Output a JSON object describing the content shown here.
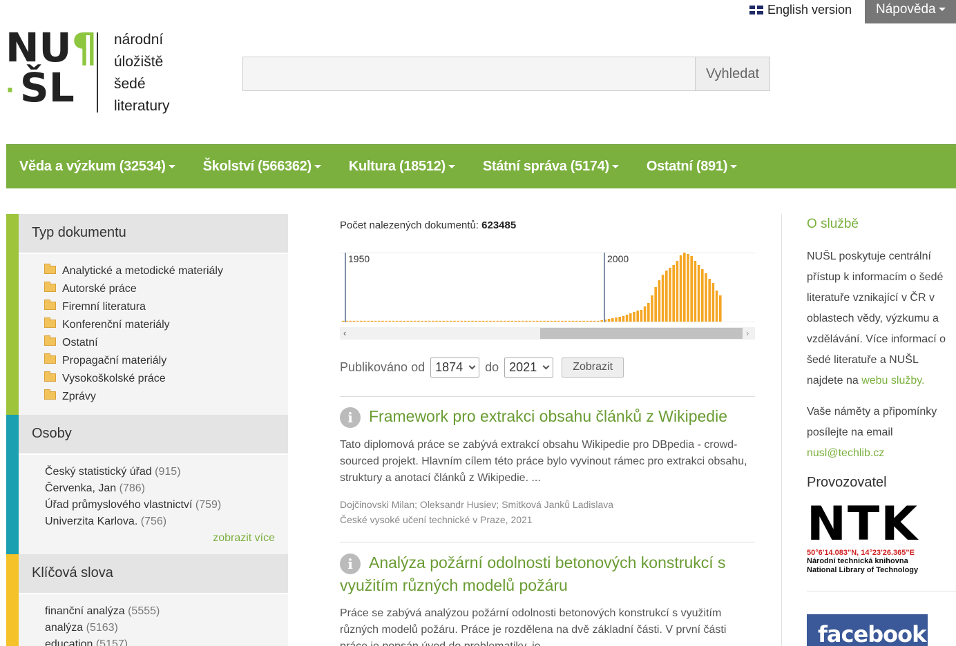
{
  "top": {
    "english_version": "English version",
    "help": "Nápověda"
  },
  "logo": {
    "mark_line1": "NU",
    "mark_para": "¶",
    "mark_line2_dot": "·",
    "mark_line2": "ŠL",
    "text_lines": [
      "národní",
      "úložiště",
      "šedé",
      "literatury"
    ]
  },
  "search": {
    "value": "",
    "button": "Vyhledat"
  },
  "nav": {
    "items": [
      "Věda a výzkum (32534)",
      "Školství (566362)",
      "Kultura (18512)",
      "Státní správa (5174)",
      "Ostatní (891)"
    ]
  },
  "facets": {
    "doc_type": {
      "title": "Typ dokumentu",
      "color": "#9dc43b",
      "items": [
        "Analytické a metodické materiály",
        "Autorské práce",
        "Firemní literatura",
        "Konferenční materiály",
        "Ostatní",
        "Propagační materiály",
        "Vysokoškolské práce",
        "Zprávy"
      ]
    },
    "persons": {
      "title": "Osoby",
      "color": "#1aa0b0",
      "items": [
        {
          "name": "Český statistický úřad",
          "count": "(915)"
        },
        {
          "name": "Červenka, Jan",
          "count": "(786)"
        },
        {
          "name": "Úřad průmyslového vlastnictví",
          "count": "(759)"
        },
        {
          "name": "Univerzita Karlova.",
          "count": "(756)"
        }
      ],
      "more": "zobrazit více"
    },
    "keywords": {
      "title": "Klíčová slova",
      "color": "#f5c22a",
      "items": [
        {
          "name": "finanční analýza",
          "count": "(5555)"
        },
        {
          "name": "analýza",
          "count": "(5163)"
        },
        {
          "name": "education",
          "count": "(5157)"
        }
      ]
    }
  },
  "results": {
    "count_label": "Počet nalezených dokumentů:",
    "count_value": "623485",
    "histogram": {
      "marker1": "1950",
      "marker2": "2000",
      "bar_color": "#f5a623",
      "bars": [
        0,
        0,
        0,
        0,
        0,
        0,
        0,
        0,
        0,
        0,
        0,
        0,
        0,
        0,
        0,
        0,
        0,
        0,
        0,
        0,
        0,
        0,
        0,
        0,
        0,
        0,
        0,
        0,
        0,
        0,
        0,
        0,
        0,
        0,
        0,
        0,
        0,
        0,
        0,
        0,
        0,
        0,
        0,
        0,
        0,
        0,
        0,
        0,
        0,
        0,
        0,
        0,
        0,
        0,
        0,
        0,
        0,
        0,
        0,
        0,
        0,
        0,
        0,
        0,
        0,
        0,
        0,
        0,
        0,
        0,
        1,
        1,
        2,
        3,
        4,
        5,
        6,
        7,
        8,
        10,
        12,
        14,
        16,
        17,
        22,
        27,
        38,
        50,
        60,
        68,
        74,
        78,
        82,
        88,
        96,
        100,
        98,
        95,
        88,
        82,
        76,
        70,
        62,
        56,
        45,
        38
      ],
      "scroll_left": "‹",
      "scroll_right": "›"
    },
    "published_from_label": "Publikováno od",
    "from_year": "1874",
    "to_label": "do",
    "to_year": "2021",
    "show_button": "Zobrazit",
    "records": [
      {
        "title": "Framework pro extrakci obsahu článků z Wikipedie",
        "abstract": "Tato diplomová práce se zabývá extrakcí obsahu Wikipedie pro DBpedia - crowd-sourced projekt. Hlavním cílem této práce bylo vyvinout rámec pro extrakci obsahu, struktury a anotací článků z Wikipedie. ...",
        "authors": "Dojčinovski Milan; Oleksandr Husiev; Smitková Janků Ladislava",
        "publisher": "České vysoké učení technické v Praze, 2021"
      },
      {
        "title": "Analýza požární odolnosti betonových konstrukcí s využitím různých modelů požáru",
        "abstract": "Práce se zabývá analýzou požární odolnosti betonových konstrukcí s využitím různých modelů požáru. Práce je rozdělena na dvě základní části. V první části práce je popsán úvod do problematiky, je"
      }
    ]
  },
  "sidebar_right": {
    "about_title": "O službě",
    "about_text": "NUŠL poskytuje centrální přístup k informacím o šedé literatuře vznikající v ČR v oblastech vědy, výzkumu a vzdělávání. Více informací o šedé literatuře a NUŠL najdete na",
    "about_link": "webu služby.",
    "suggestions_text": "Vaše náměty a připomínky posílejte na email",
    "email": "nusl@techlib.cz",
    "operator_title": "Provozovatel",
    "ntk_logo": "NTK",
    "ntk_coords": "50°6'14.083\"N, 14°23'26.365\"E",
    "ntk_cz": "Národní technická knihovna",
    "ntk_en": "National Library of Technology",
    "facebook": "facebook"
  }
}
